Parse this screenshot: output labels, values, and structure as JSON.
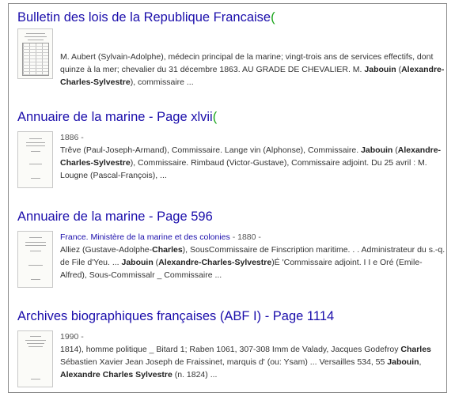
{
  "results": [
    {
      "title": "Bulletin des lois de la Republique Francaise",
      "title_cut": "(",
      "meta": "",
      "meta_link": "",
      "snippet_parts": [
        {
          "t": "M. Aubert (Sylvain-Adolphe), médecin principal de la marine; vingt-trois ans de services effectifs, dont quinze à la mer; chevalier du 31 décembre 1863. AU GRADE DE CHEVALIER. M. ",
          "b": false
        },
        {
          "t": "Jabouin",
          "b": true
        },
        {
          "t": " (",
          "b": false
        },
        {
          "t": "Alexandre-Charles-Sylvestre",
          "b": true
        },
        {
          "t": "), commissaire ...",
          "b": false
        }
      ]
    },
    {
      "title": "Annuaire de la marine - Page xlvii",
      "title_cut": "(",
      "meta": "1886 -",
      "meta_link": "",
      "snippet_parts": [
        {
          "t": "Trêve (Paul-Joseph-Armand), Commissaire. Lange vin (Alphonse), Commissaire. ",
          "b": false
        },
        {
          "t": "Jabouin",
          "b": true
        },
        {
          "t": " (",
          "b": false
        },
        {
          "t": "Alexandre-Charles-Sylvestre",
          "b": true
        },
        {
          "t": "), Commissaire. Rimbaud (Victor-Gustave), Commissaire adjoint. Du 25 avril : M. Lougne (Pascal-François), ...",
          "b": false
        }
      ]
    },
    {
      "title": "Annuaire de la marine - Page 596",
      "title_cut": "",
      "meta": " - 1880 -",
      "meta_link": "France. Ministère de la marine et des colonies",
      "snippet_parts": [
        {
          "t": "Alliez (Gustave-Adolphe-",
          "b": false
        },
        {
          "t": "Charles",
          "b": true
        },
        {
          "t": "), SousCommissaire de Finscription maritime. . . Administrateur du s.-q. de File d'Yeu. ... ",
          "b": false
        },
        {
          "t": "Jabouin",
          "b": true
        },
        {
          "t": " (",
          "b": false
        },
        {
          "t": "Alexandre-Charles-Sylvestre",
          "b": true
        },
        {
          "t": ")É 'Commissaire adjoint. I I e Oré (Emile-Alfred), Sous-Commissalr _ Commissaire ...",
          "b": false
        }
      ]
    },
    {
      "title": "Archives biographiques françaises (ABF I) - Page 1114",
      "title_cut": "",
      "meta": "1990 -",
      "meta_link": "",
      "snippet_parts": [
        {
          "t": "1814), homme politique _ Bitard 1; Raben 1061, 307-308 Imm de Valady, Jacques Godefroy ",
          "b": false
        },
        {
          "t": "Charles",
          "b": true
        },
        {
          "t": " Sébastien Xavier Jean Joseph de Fraissinet, marquis d' (ou: Ysam) ... Versailles 534, 55 ",
          "b": false
        },
        {
          "t": "Jabouin",
          "b": true
        },
        {
          "t": ", ",
          "b": false
        },
        {
          "t": "Alexandre Charles Sylvestre",
          "b": true
        },
        {
          "t": " (n. 1824) ...",
          "b": false
        }
      ]
    }
  ]
}
